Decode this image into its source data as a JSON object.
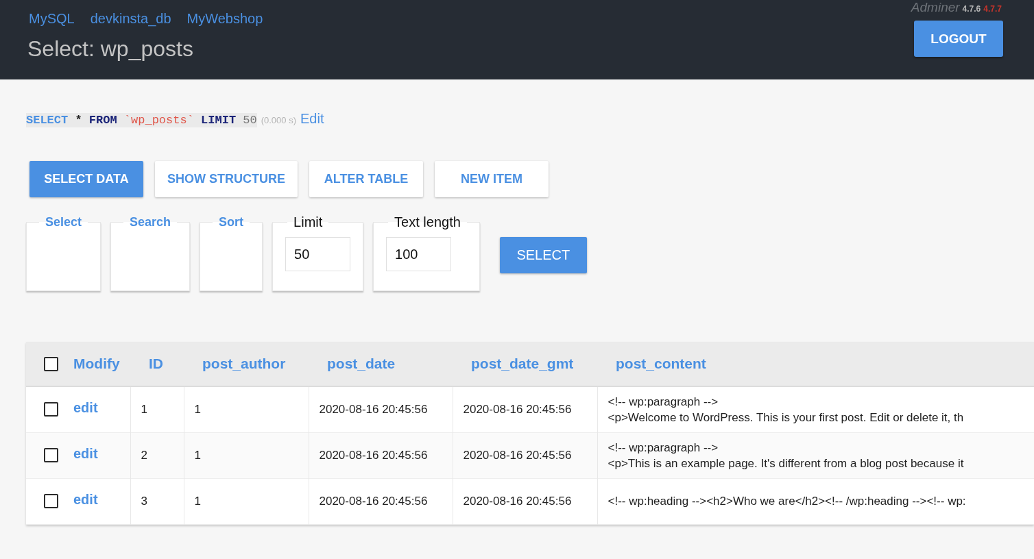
{
  "header": {
    "breadcrumbs": [
      "MySQL",
      "devkinsta_db",
      "MyWebshop"
    ],
    "title": "Select: wp_posts",
    "app": {
      "name": "Adminer",
      "version": "4.7.6",
      "new_version": "4.7.7"
    },
    "logout_button": "LOGOUT"
  },
  "query": {
    "tokens": [
      {
        "text": "SELECT",
        "kind": "command"
      },
      {
        "text": "*",
        "kind": "symbol"
      },
      {
        "text": "FROM",
        "kind": "keyword"
      },
      {
        "text": "`wp_posts`",
        "kind": "identifier"
      },
      {
        "text": "LIMIT",
        "kind": "keyword"
      },
      {
        "text": "50",
        "kind": "number"
      }
    ],
    "time": "(0.000 s)",
    "edit_link": "Edit"
  },
  "actions": [
    {
      "label": "SELECT DATA",
      "selected": true
    },
    {
      "label": "SHOW STRUCTURE",
      "selected": false
    },
    {
      "label": "ALTER TABLE",
      "selected": false
    },
    {
      "label": "NEW ITEM",
      "selected": false
    }
  ],
  "form": {
    "fieldsets": [
      {
        "legend": "Select",
        "kind": "toggle"
      },
      {
        "legend": "Search",
        "kind": "toggle"
      },
      {
        "legend": "Sort",
        "kind": "toggle"
      },
      {
        "legend": "Limit",
        "kind": "input",
        "value": "50"
      },
      {
        "legend": "Text length",
        "kind": "input",
        "value": "100"
      }
    ],
    "submit_button": "SELECT"
  },
  "table": {
    "select_all": {
      "checked": false
    },
    "columns": [
      "Modify",
      "ID",
      "post_author",
      "post_date",
      "post_date_gmt",
      "post_content"
    ],
    "rows": [
      {
        "checked": false,
        "cells": [
          "edit",
          "1",
          "1",
          "2020-08-16 20:45:56",
          "2020-08-16 20:45:56",
          "<!-- wp:paragraph -->\n<p>Welcome to WordPress. This is your first post. Edit or delete it, th"
        ]
      },
      {
        "checked": false,
        "cells": [
          "edit",
          "2",
          "1",
          "2020-08-16 20:45:56",
          "2020-08-16 20:45:56",
          "<!-- wp:paragraph -->\n<p>This is an example page. It's different from a blog post because it"
        ]
      },
      {
        "checked": false,
        "cells": [
          "edit",
          "3",
          "1",
          "2020-08-16 20:45:56",
          "2020-08-16 20:45:56",
          "<!-- wp:heading --><h2>Who we are</h2><!-- /wp:heading --><!-- wp:"
        ]
      }
    ]
  }
}
